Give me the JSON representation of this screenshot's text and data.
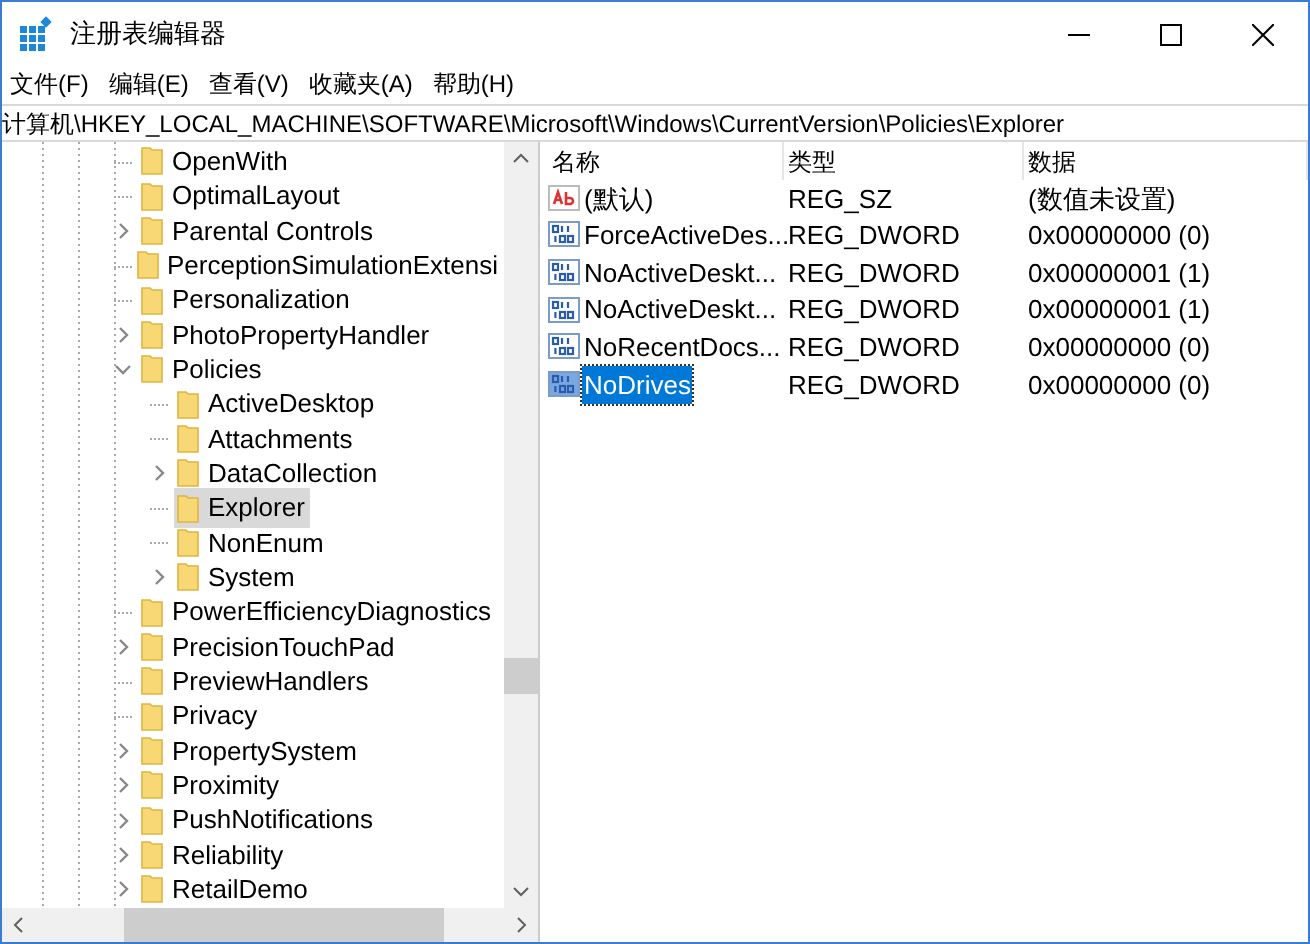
{
  "window": {
    "title": "注册表编辑器"
  },
  "menu": [
    "文件(F)",
    "编辑(E)",
    "查看(V)",
    "收藏夹(A)",
    "帮助(H)"
  ],
  "address": "计算机\\HKEY_LOCAL_MACHINE\\SOFTWARE\\Microsoft\\Windows\\CurrentVersion\\Policies\\Explorer",
  "tree": [
    {
      "label": "OpenWith",
      "expandable": false,
      "expanded": false,
      "selected": false
    },
    {
      "label": "OptimalLayout",
      "expandable": false,
      "expanded": false,
      "selected": false
    },
    {
      "label": "Parental Controls",
      "expandable": true,
      "expanded": false,
      "selected": false
    },
    {
      "label": "PerceptionSimulationExtensi",
      "expandable": false,
      "expanded": false,
      "selected": false
    },
    {
      "label": "Personalization",
      "expandable": false,
      "expanded": false,
      "selected": false
    },
    {
      "label": "PhotoPropertyHandler",
      "expandable": true,
      "expanded": false,
      "selected": false
    },
    {
      "label": "Policies",
      "expandable": true,
      "expanded": true,
      "selected": false,
      "children": [
        {
          "label": "ActiveDesktop",
          "expandable": false,
          "expanded": false,
          "selected": false
        },
        {
          "label": "Attachments",
          "expandable": false,
          "expanded": false,
          "selected": false
        },
        {
          "label": "DataCollection",
          "expandable": true,
          "expanded": false,
          "selected": false
        },
        {
          "label": "Explorer",
          "expandable": false,
          "expanded": false,
          "selected": true
        },
        {
          "label": "NonEnum",
          "expandable": false,
          "expanded": false,
          "selected": false
        },
        {
          "label": "System",
          "expandable": true,
          "expanded": false,
          "selected": false
        }
      ]
    },
    {
      "label": "PowerEfficiencyDiagnostics",
      "expandable": false,
      "expanded": false,
      "selected": false
    },
    {
      "label": "PrecisionTouchPad",
      "expandable": true,
      "expanded": false,
      "selected": false
    },
    {
      "label": "PreviewHandlers",
      "expandable": false,
      "expanded": false,
      "selected": false
    },
    {
      "label": "Privacy",
      "expandable": false,
      "expanded": false,
      "selected": false
    },
    {
      "label": "PropertySystem",
      "expandable": true,
      "expanded": false,
      "selected": false
    },
    {
      "label": "Proximity",
      "expandable": true,
      "expanded": false,
      "selected": false
    },
    {
      "label": "PushNotifications",
      "expandable": true,
      "expanded": false,
      "selected": false
    },
    {
      "label": "Reliability",
      "expandable": true,
      "expanded": false,
      "selected": false
    },
    {
      "label": "RetailDemo",
      "expandable": true,
      "expanded": false,
      "selected": false
    }
  ],
  "columns": [
    "名称",
    "类型",
    "数据"
  ],
  "values": [
    {
      "kind": "string",
      "name": "(默认)",
      "type": "REG_SZ",
      "data": "(数值未设置)",
      "selected": false
    },
    {
      "kind": "binary",
      "name": "ForceActiveDes...",
      "type": "REG_DWORD",
      "data": "0x00000000 (0)",
      "selected": false
    },
    {
      "kind": "binary",
      "name": "NoActiveDeskt...",
      "type": "REG_DWORD",
      "data": "0x00000001 (1)",
      "selected": false
    },
    {
      "kind": "binary",
      "name": "NoActiveDeskt...",
      "type": "REG_DWORD",
      "data": "0x00000001 (1)",
      "selected": false
    },
    {
      "kind": "binary",
      "name": "NoRecentDocs...",
      "type": "REG_DWORD",
      "data": "0x00000000 (0)",
      "selected": false
    },
    {
      "kind": "binary",
      "name": "NoDrives",
      "type": "REG_DWORD",
      "data": "0x00000000 (0)",
      "selected": true
    }
  ]
}
